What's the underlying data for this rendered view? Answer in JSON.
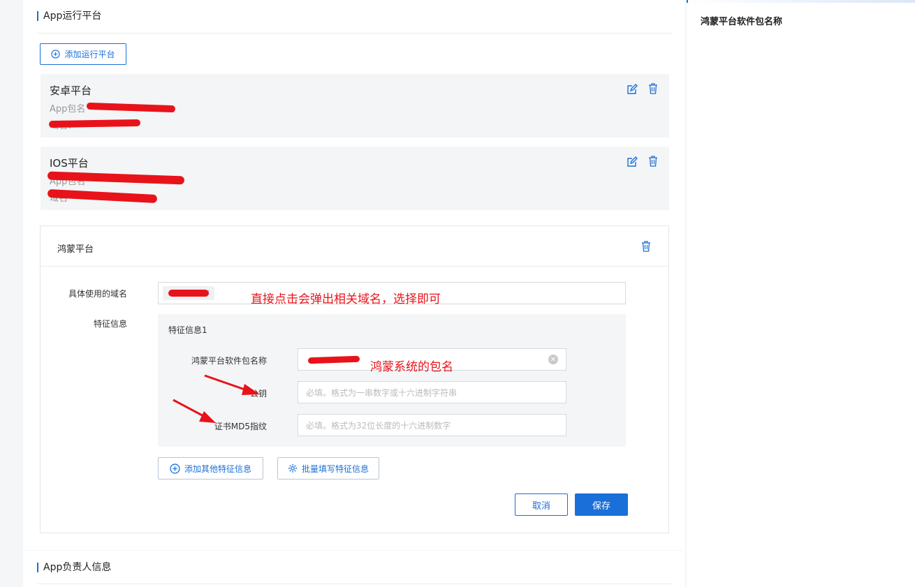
{
  "section_app_platform": {
    "title": "App运行平台",
    "add_button": "添加运行平台"
  },
  "platforms": [
    {
      "name": "安卓平台",
      "line1": "App包名",
      "line2": "域名："
    },
    {
      "name": "IOS平台",
      "line1": "App包名",
      "line2": "域名"
    }
  ],
  "harmony": {
    "title": "鸿蒙平台",
    "domain_label": "具体使用的域名",
    "feature_label": "特征信息",
    "feature_group_title": "特征信息1",
    "pkg_label": "鸿蒙平台软件包名称",
    "pubkey_label": "公钥",
    "pubkey_placeholder": "必填。格式为一串数字或十六进制字符串",
    "md5_label": "证书MD5指纹",
    "md5_placeholder": "必填。格式为32位长度的十六进制数字",
    "add_feature_button": "添加其他特征信息",
    "batch_button": "批量填写特征信息",
    "cancel_button": "取消",
    "save_button": "保存"
  },
  "annotations": {
    "domain_hint": "直接点击会弹出相关域名，选择即可",
    "pkg_hint": "鸿蒙系统的包名"
  },
  "section_owner": {
    "title": "App负责人信息"
  },
  "right_panel": {
    "title": "鸿蒙平台软件包名称"
  },
  "colors": {
    "accent": "#1a6fd8",
    "annotation": "#e8131a"
  }
}
